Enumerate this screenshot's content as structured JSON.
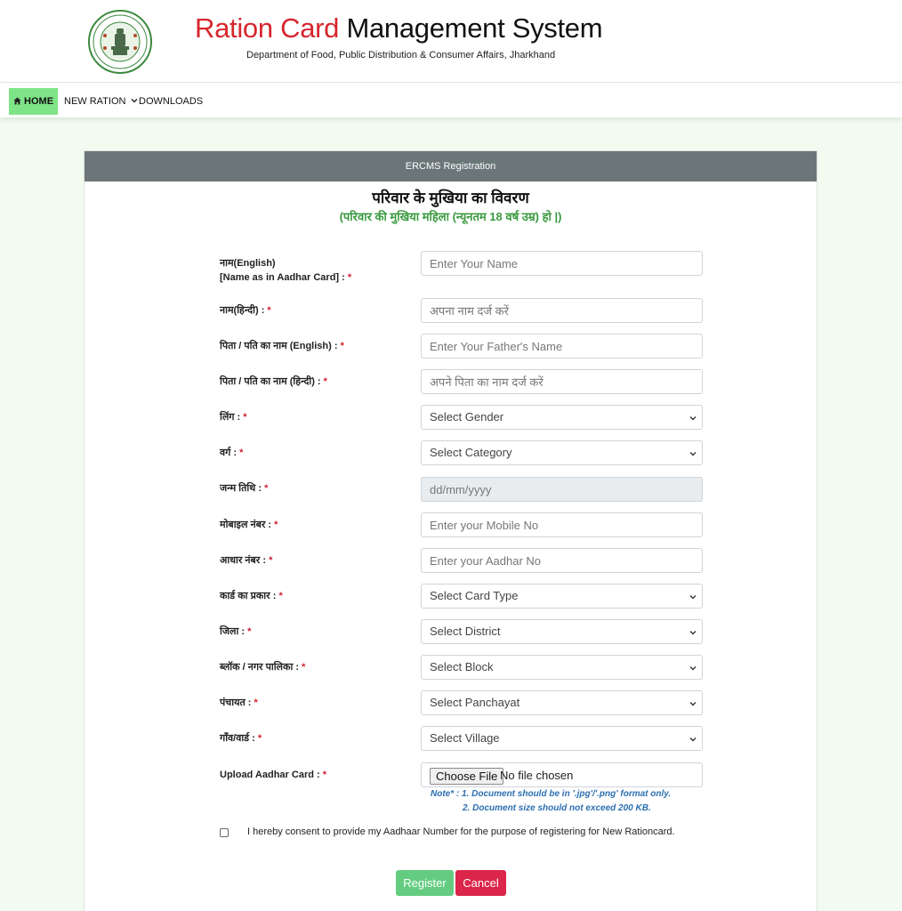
{
  "header": {
    "title_red": "Ration Card",
    "title_black": "Management System",
    "subtitle": "Department of Food, Public Distribution & Consumer Affairs, Jharkhand",
    "emblem_icon": "state-emblem-icon"
  },
  "nav": {
    "home": "HOME",
    "new_ration": "NEW RATION",
    "downloads": "DOWNLOADS"
  },
  "card": {
    "header": "ERCMS Registration",
    "title": "परिवार के मुखिया का विवरण",
    "subtitle": "(परिवार की मुखिया महिला (न्यूनतम 18 वर्ष उम्र) हो |)"
  },
  "form": {
    "required_mark": "*",
    "name_en": {
      "label_line1": "नाम(English)",
      "label_line2": "[Name as in Aadhar Card] :",
      "placeholder": "Enter Your Name"
    },
    "name_hi": {
      "label": "नाम(हिन्दी) :",
      "placeholder": "अपना नाम दर्ज करें"
    },
    "father_en": {
      "label": "पिता / पति का नाम (English) :",
      "placeholder": "Enter Your Father's Name"
    },
    "father_hi": {
      "label": "पिता / पति का नाम (हिन्दी) :",
      "placeholder": "अपने पिता का नाम दर्ज करें"
    },
    "gender": {
      "label": "लिंग :",
      "selected": "Select Gender"
    },
    "category": {
      "label": "वर्ग :",
      "selected": "Select Category"
    },
    "dob": {
      "label": "जन्म तिथि :",
      "placeholder": "dd/mm/yyyy"
    },
    "mobile": {
      "label": "मोबाइल नंबर :",
      "placeholder": "Enter your Mobile No"
    },
    "aadhar": {
      "label": "आधार नंबर :",
      "placeholder": "Enter your Aadhar No"
    },
    "card_type": {
      "label": "कार्ड का प्रकार :",
      "selected": "Select Card Type"
    },
    "district": {
      "label": "जिला :",
      "selected": "Select District"
    },
    "block": {
      "label": "ब्लॉक / नगर पालिका :",
      "selected": "Select Block"
    },
    "panchayat": {
      "label": "पंचायत :",
      "selected": "Select Panchayat"
    },
    "village": {
      "label": "गाँव/वार्ड :",
      "selected": "Select Village"
    },
    "upload": {
      "label": "Upload Aadhar Card :",
      "button": "Choose File",
      "status": "No file chosen"
    },
    "note_line1": "Note* : 1. Document should be in '.jpg'/'.png' format only.",
    "note_line2": "2. Document size should not exceed 200 KB.",
    "consent": "I hereby consent to provide my Aadhaar Number for the purpose of registering for New Rationcard."
  },
  "buttons": {
    "register": "Register",
    "cancel": "Cancel"
  },
  "colors": {
    "title_red": "#d7262e",
    "nav_active": "#7fe488",
    "card_header": "#6b7679",
    "subtitle_green": "#3a9a3f",
    "note_blue": "#2c6fb0",
    "register": "#64cc81",
    "cancel": "#db2549",
    "page_bg": "#f1fbef"
  }
}
